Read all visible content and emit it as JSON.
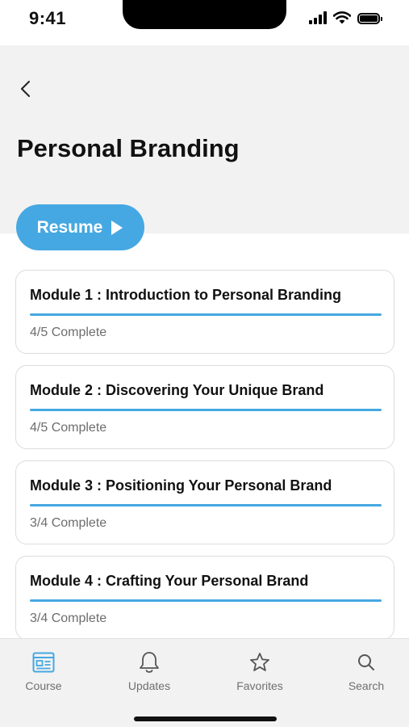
{
  "status_bar": {
    "time": "9:41",
    "icons": [
      "signal-icon",
      "wifi-icon",
      "battery-icon"
    ]
  },
  "header": {
    "back_icon": "chevron-left-icon",
    "title": "Personal Branding",
    "resume_label": "Resume",
    "resume_icon": "play-icon"
  },
  "modules": [
    {
      "title": "Module 1 : Introduction to Personal Branding",
      "status": "4/5 Complete",
      "progress": 1.0
    },
    {
      "title": "Module 2 : Discovering Your Unique Brand",
      "status": "4/5 Complete",
      "progress": 1.0
    },
    {
      "title": "Module 3 : Positioning Your Personal Brand",
      "status": "3/4 Complete",
      "progress": 1.0
    },
    {
      "title": "Module 4 : Crafting Your Personal Brand",
      "status": "3/4 Complete",
      "progress": 1.0
    }
  ],
  "tab_bar": {
    "tabs": [
      {
        "label": "Course",
        "icon": "course-icon",
        "active": true
      },
      {
        "label": "Updates",
        "icon": "bell-icon",
        "active": false
      },
      {
        "label": "Favorites",
        "icon": "star-icon",
        "active": false
      },
      {
        "label": "Search",
        "icon": "search-icon",
        "active": false
      }
    ]
  },
  "colors": {
    "accent": "#45a8e2",
    "header_bg": "#f2f2f2",
    "tab_bg": "#f2f2f2",
    "muted_text": "#6d6d6d"
  }
}
